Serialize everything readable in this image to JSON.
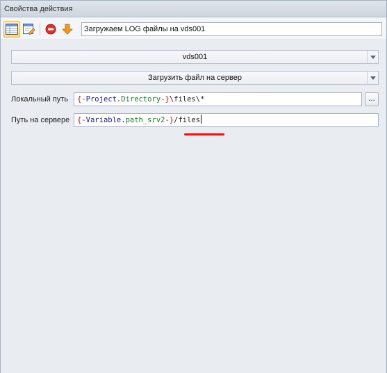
{
  "window": {
    "title": "Свойства действия"
  },
  "toolbar": {
    "action_name": "Загружаем LOG файлы на vds001"
  },
  "form": {
    "server_combo": "vds001",
    "operation_combo": "Загрузить файл на сервер",
    "local_path": {
      "label": "Локальный путь",
      "open_brace": "{-",
      "var": "Project",
      "dot": ".",
      "prop": "Directory",
      "close_brace": "-}",
      "tail": "\\files\\*",
      "browse_label": "..."
    },
    "server_path": {
      "label": "Путь на сервере",
      "open_brace": "{-",
      "var": "Variable",
      "dot": ".",
      "prop": "path_srv2",
      "close_brace": "-}",
      "tail": "/files"
    }
  },
  "colors": {
    "accent_underline": "#e3191c",
    "brace": "#c62020",
    "variable_name": "#1f1f8f",
    "property_name": "#1a7d2a"
  }
}
